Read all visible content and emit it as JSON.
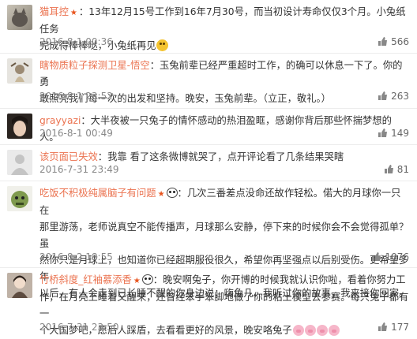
{
  "comments": [
    {
      "user": "猫耳控",
      "sep": "：",
      "text_line1": "13年12月15号工作到16年7月30号，而当初设计寿命仅仅3个月。小兔纸任务",
      "text_line2": "完成得棒棒哒，小兔纸再见",
      "time": "2016-8-1 00:36",
      "likes": "566",
      "emoji": "blush-emoji"
    },
    {
      "user": "瞎物质粒子探测卫星-悟空",
      "sep": "：",
      "text_line1": "玉兔前辈已经严重超时工作，的确可以休息一下了。你的勇",
      "text_line2": "敢照亮我们每一次的出发和坚持。晚安，玉兔前辈。（立正，敬礼。）",
      "time": "2016-8-1 23:52",
      "likes": "263"
    },
    {
      "user": "grayyazi",
      "sep": "：",
      "text_line1": "大半夜被一只兔子的情怀感动的热泪盈眶，感谢你背后那些怀揣梦想的人。",
      "time": "2016-8-1 00:49",
      "likes": "149"
    },
    {
      "user": "该页面已失效",
      "sep": "：",
      "text_line1": "我靠 看了这条微博就哭了，点开评论看了几条结果哭瞎",
      "time": "2016-7-31 23:49",
      "likes": "81"
    },
    {
      "user": "吃饭不积极纯属脑子有问题",
      "sep": "：",
      "text_line1": "几次三番差点没命还故作轻松。偌大的月球你一只在",
      "text_line2": "那里游荡，老师说真空不能传播声，月球那么安静，停下来的时候你会不会觉得孤单？虽",
      "text_line3": "然你只是月球上，也知道你已经超期服役很久，希望你再坚强点以后别受伤。更希望多年",
      "text_line4": "以后，有人会走到已长睡不醒的你身边说：嗨兔几，我听过你的故事，我来接你回家。",
      "time": "2016-8-2 18:55",
      "likes": "1076"
    },
    {
      "user": "竹桥斜度_红袖慕添香",
      "sep": "：",
      "text_line1": "晚安啊兔子，你开博的时候我就认识你啦，看着你努力工",
      "text_line2": "作，在月亮上睡着又醒来，还曾经笨手笨脚地做了你的粘土模型去参赛。每只兔子都有一",
      "text_line3": "个大国梦吧，愿后人踩盾，去看看更好的风景，晚安咯兔子",
      "time": "2016-7-31 23:50",
      "likes": "177"
    }
  ],
  "colors": {
    "username": "#eb7350",
    "meta": "#888888",
    "divider": "#ececec"
  },
  "icons": [
    "vip-star-icon",
    "panda-icon",
    "pig-emoji",
    "like-thumb-icon"
  ]
}
